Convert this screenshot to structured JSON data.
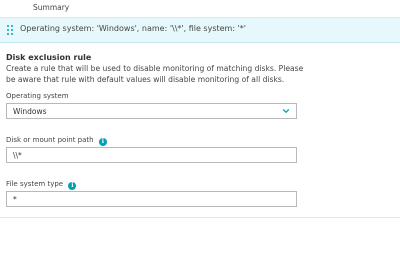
{
  "header": {
    "summary_label": "Summary"
  },
  "rule": {
    "title": "Operating system: 'Windows', name: '\\\\*', file system: '*'"
  },
  "form": {
    "section_title": "Disk exclusion rule",
    "description": "Create a rule that will be used to disable monitoring of matching disks. Please be aware that rule with default values will disable monitoring of all disks.",
    "os": {
      "label": "Operating system",
      "value": "Windows"
    },
    "path": {
      "label": "Disk or mount point path",
      "value": "\\\\*"
    },
    "fs": {
      "label": "File system type",
      "value": "*"
    }
  },
  "colors": {
    "accent": "#00a1b2",
    "row_bg": "#e6f8fb"
  },
  "icons": [
    "drag-handle-icon",
    "info-icon",
    "chevron-down-icon"
  ]
}
